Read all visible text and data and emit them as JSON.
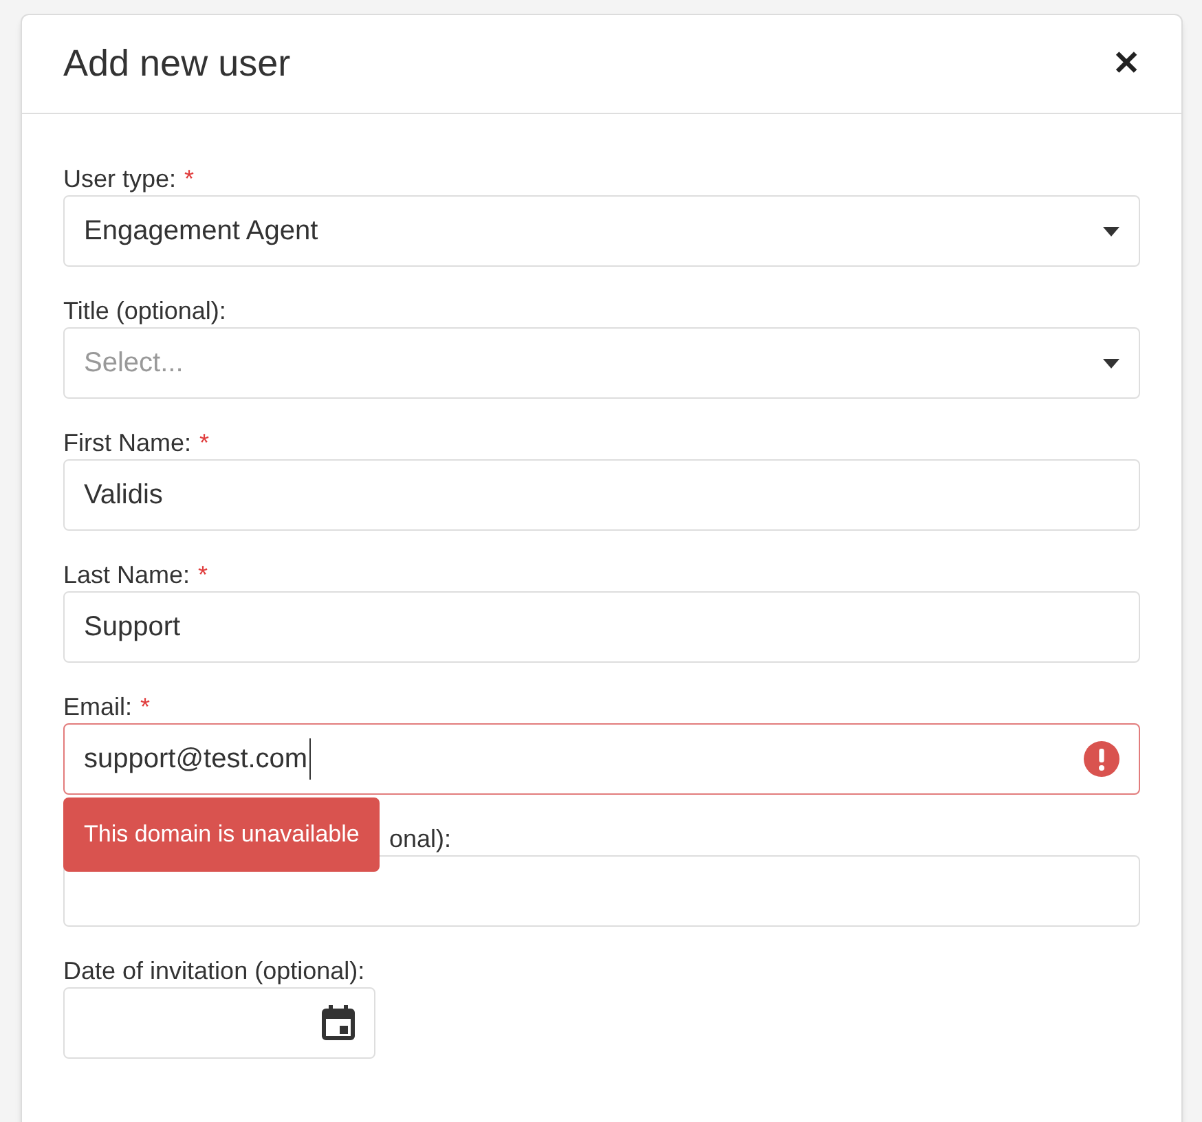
{
  "dialog": {
    "title": "Add new user",
    "close": "✕"
  },
  "fields": [
    {
      "kind": "select",
      "label": "User type:",
      "required_mark": "*",
      "value": "Engagement Agent"
    },
    {
      "kind": "select",
      "label": "Title (optional):",
      "placeholder": "Select..."
    },
    {
      "kind": "text",
      "label": "First Name:",
      "required_mark": "*",
      "value": "Validis"
    },
    {
      "kind": "text",
      "label": "Last Name:",
      "required_mark": "*",
      "value": "Support"
    },
    {
      "kind": "text",
      "label": "Email:",
      "required_mark": "*",
      "value": "support@test.com",
      "invalid": true,
      "error": "This domain is unavailable"
    },
    {
      "kind": "text",
      "label": "onal):"
    },
    {
      "kind": "date",
      "label": "Date of invitation (optional):"
    }
  ]
}
